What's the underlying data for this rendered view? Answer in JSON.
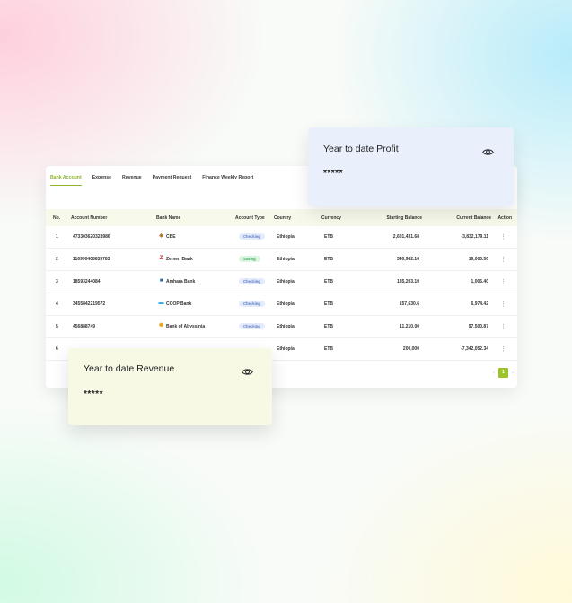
{
  "tabs": [
    "Bank Account",
    "Expense",
    "Revenue",
    "Payment Request",
    "Finance Weekly Report"
  ],
  "active_tab": "Bank Account",
  "columns": {
    "no": "No.",
    "account_number": "Account Number",
    "bank_name": "Bank Name",
    "account_type": "Account Type",
    "country": "Country",
    "currency": "Currency",
    "starting_balance": "Starting Balance",
    "current_balance": "Current Balance",
    "action": "Action"
  },
  "rows": [
    {
      "no": "1",
      "account": "4733036203289​86",
      "bank": "CBE",
      "logo": "cbe-logo-icon",
      "logo_color": "#b7762b",
      "type": "Checking",
      "country": "Ethiopia",
      "currency": "ETB",
      "start": "2,601,431.68",
      "current": "-3,832,179.11"
    },
    {
      "no": "2",
      "account": "116990408635783",
      "bank": "Zemen Bank",
      "logo": "zemen-logo-icon",
      "logo_color": "#d3262f",
      "type": "Saving",
      "country": "Ethiopia",
      "currency": "ETB",
      "start": "340,962.10",
      "current": "16,000.50"
    },
    {
      "no": "3",
      "account": "18593244084",
      "bank": "Amhara Bank",
      "logo": "amhara-logo-icon",
      "logo_color": "#1f6bb5",
      "type": "Checking",
      "country": "Ethiopia",
      "currency": "ETB",
      "start": "185,203.10",
      "current": "1,005.40"
    },
    {
      "no": "4",
      "account": "3455842219572",
      "bank": "COOP Bank",
      "logo": "coop-logo-icon",
      "logo_color": "#2aa5d8",
      "type": "Checking",
      "country": "Ethiopia",
      "currency": "ETB",
      "start": "157,630.6",
      "current": "6,974.42"
    },
    {
      "no": "5",
      "account": "456888749",
      "bank": "Bank of Abyssinia",
      "logo": "abyssinia-logo-icon",
      "logo_color": "#e9a41c",
      "type": "Checking",
      "country": "Ethiopia",
      "currency": "ETB",
      "start": "11,210.00",
      "current": "97,500.87"
    },
    {
      "no": "6",
      "account": "",
      "bank": "",
      "logo": "",
      "logo_color": "",
      "type": "",
      "country": "Ethiopia",
      "currency": "ETB",
      "start": "200,000",
      "current": "-7,342,052.34"
    }
  ],
  "pagination": {
    "prev": "‹",
    "page": "1",
    "next": "›"
  },
  "profit_card": {
    "title": "Year to date Profit",
    "value": "*****",
    "icon": "eye-icon"
  },
  "revenue_card": {
    "title": "Year to date Revenue",
    "value": "*****",
    "icon": "eye-icon"
  },
  "colors": {
    "accent": "#8cb62f",
    "page_badge": "#9cc32b",
    "profit_bg": "#eaf0fb",
    "revenue_bg": "#f7f9e5",
    "header_bg": "#f7f9ea"
  }
}
